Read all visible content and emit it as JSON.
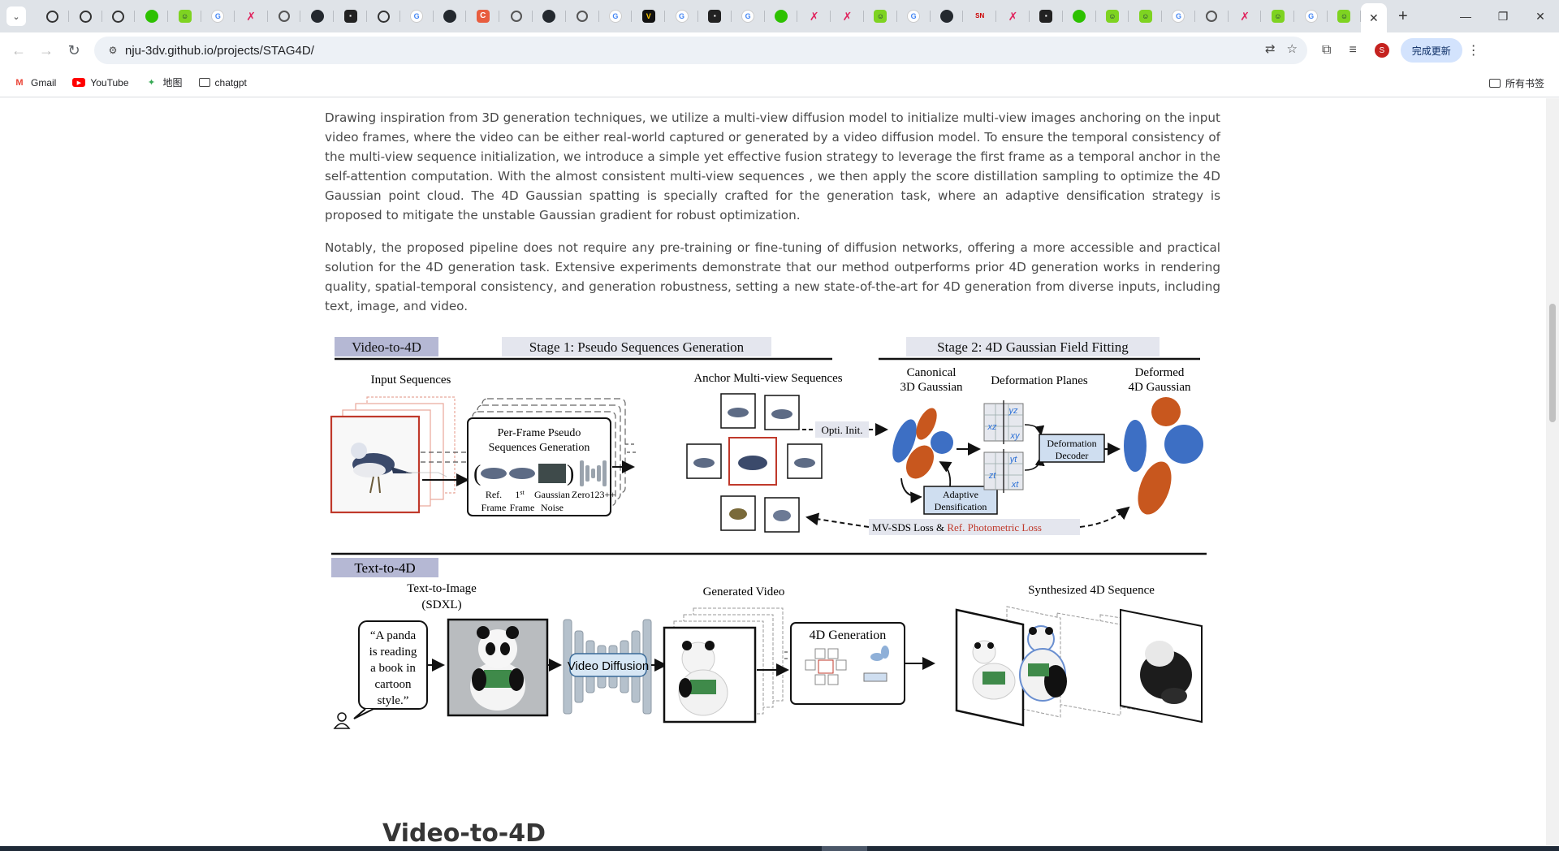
{
  "browser": {
    "tabs": [
      {
        "icon": "openai-icon"
      },
      {
        "icon": "openai-icon"
      },
      {
        "icon": "openai-icon"
      },
      {
        "icon": "wechat-icon"
      },
      {
        "icon": "smile-icon"
      },
      {
        "icon": "google-icon"
      },
      {
        "icon": "x-icon"
      },
      {
        "icon": "globe-icon"
      },
      {
        "icon": "github-icon"
      },
      {
        "icon": "dark-icon"
      },
      {
        "icon": "openai-icon"
      },
      {
        "icon": "google-icon"
      },
      {
        "icon": "github-icon"
      },
      {
        "icon": "orange-icon"
      },
      {
        "icon": "globe-icon"
      },
      {
        "icon": "github-icon"
      },
      {
        "icon": "globe-icon"
      },
      {
        "icon": "google-icon"
      },
      {
        "icon": "vbrand-icon"
      },
      {
        "icon": "google-icon"
      },
      {
        "icon": "dark-icon"
      },
      {
        "icon": "google-icon"
      },
      {
        "icon": "wechat-icon"
      },
      {
        "icon": "x-icon"
      },
      {
        "icon": "x-icon"
      },
      {
        "icon": "smile-icon"
      },
      {
        "icon": "google-icon"
      },
      {
        "icon": "github-icon"
      },
      {
        "icon": "sn-icon"
      },
      {
        "icon": "x-icon"
      },
      {
        "icon": "dark-icon"
      },
      {
        "icon": "wechat-icon"
      },
      {
        "icon": "smile-icon"
      },
      {
        "icon": "smile-icon"
      },
      {
        "icon": "google-icon"
      },
      {
        "icon": "globe-icon"
      },
      {
        "icon": "x-icon"
      },
      {
        "icon": "smile-icon"
      },
      {
        "icon": "google-icon"
      },
      {
        "icon": "smile-icon"
      }
    ],
    "url": "nju-3dv.github.io/projects/STAG4D/",
    "update_button": "完成更新",
    "profile_initial": "S",
    "bookmarks": [
      {
        "label": "Gmail",
        "icon": "gmail-icon"
      },
      {
        "label": "YouTube",
        "icon": "youtube-icon"
      },
      {
        "label": "地图",
        "icon": "maps-icon"
      },
      {
        "label": "chatgpt",
        "icon": "folder-icon"
      }
    ],
    "all_bookmarks": "所有书签"
  },
  "page": {
    "paragraph_1": "Drawing inspiration from 3D generation techniques, we utilize a multi-view diffusion model to initialize multi-view images anchoring on the input video frames, where the video can be either real-world captured or generated by a video diffusion model. To ensure the temporal consistency of the multi-view sequence initialization, we introduce a simple yet effective fusion strategy to leverage the first frame as a temporal anchor in the self-attention computation. With the almost consistent multi-view sequences , we then apply the score distillation sampling to optimize the 4D Gaussian point cloud. The 4D Gaussian spatting is specially crafted for the generation task, where an adaptive densification strategy is proposed to mitigate the unstable Gaussian gradient for robust optimization.",
    "paragraph_2": "Notably, the proposed pipeline does not require any pre-training or fine-tuning of diffusion networks, offering a more accessible and practical solution for the 4D generation task. Extensive experiments demonstrate that our method outperforms prior 4D generation works in rendering quality, spatial-temporal consistency, and generation robustness, setting a new state-of-the-art for 4D generation from diverse inputs, including text, image, and video.",
    "section_heading": "Video-to-4D"
  },
  "figure": {
    "video_to_4d": "Video-to-4D",
    "stage1": "Stage 1: Pseudo Sequences Generation",
    "stage2": "Stage 2: 4D Gaussian Field Fitting",
    "input_sequences": "Input Sequences",
    "per_frame_1": "Per-Frame Pseudo",
    "per_frame_2": "Sequences Generation",
    "ref": "Ref.",
    "frame": "Frame",
    "first": "1",
    "first_sup": "st",
    "gaussian": "Gaussian",
    "noise": "Noise",
    "zero123": "Zero123++",
    "anchor_mv": "Anchor Multi-view Sequences",
    "opti_init": "Opti. Init.",
    "canonical_1": "Canonical",
    "canonical_2": "3D Gaussian",
    "deformation_planes": "Deformation Planes",
    "deformed_1": "Deformed",
    "deformed_2": "4D Gaussian",
    "deformation": "Deformation",
    "decoder": "Decoder",
    "adaptive": "Adaptive",
    "densification": "Densification",
    "mvsds": "MV-SDS Loss & ",
    "ref_photo": "Ref. Photometric Loss",
    "plane_yz": "yz",
    "plane_xz": "xz",
    "plane_xy": "xy",
    "plane_yt": "yt",
    "plane_zt": "zt",
    "plane_xt": "xt",
    "text_to_4d": "Text-to-4D",
    "t2i_1": "Text-to-Image",
    "t2i_2": "(SDXL)",
    "prompt_1": "“A panda",
    "prompt_2": "is reading",
    "prompt_3": "a book in",
    "prompt_4": "cartoon",
    "prompt_5": "style.”",
    "video_diffusion": "Video Diffusion",
    "generated_video": "Generated Video",
    "gen_4d": "4D Generation",
    "synth_4d": "Synthesized 4D Sequence",
    "colors": {
      "blue": "#3d6fc4",
      "orange": "#c8571e",
      "red": "#c0392b",
      "label_bg": "#b5b8d4",
      "stage_bg": "#e4e6ee"
    }
  }
}
